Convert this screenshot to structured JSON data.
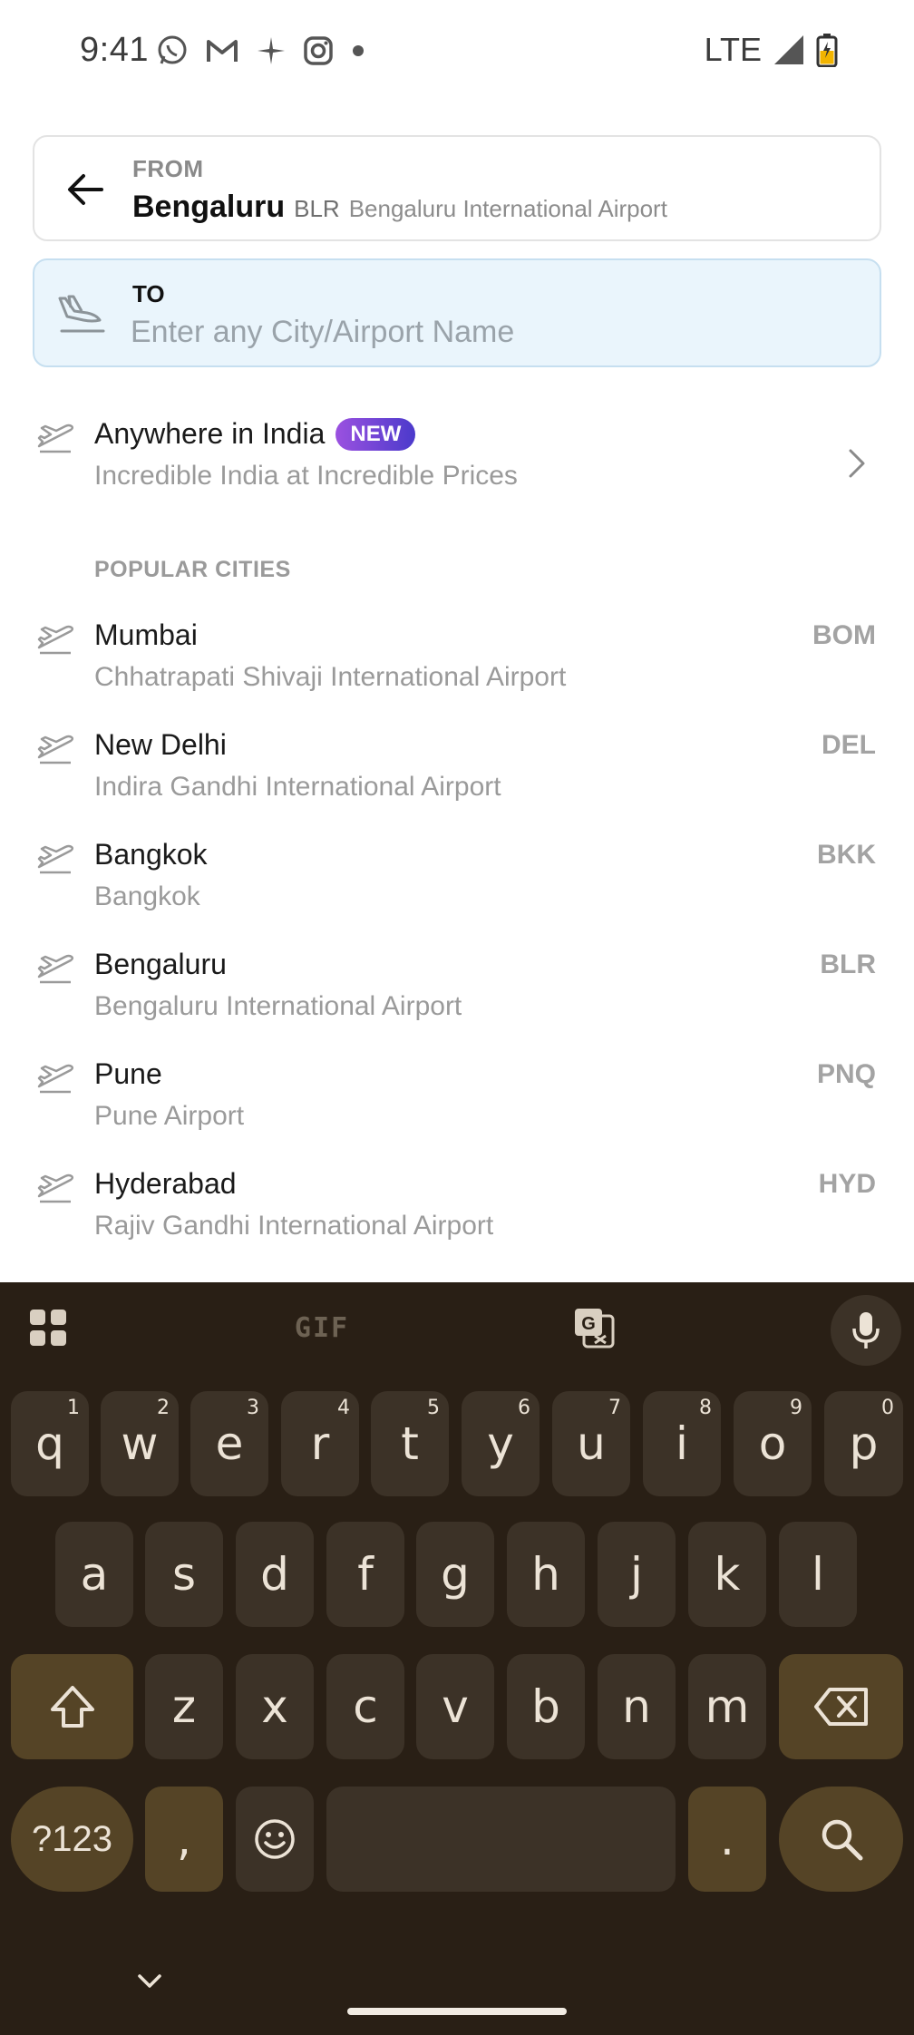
{
  "status_bar": {
    "time": "9:41",
    "notification_icons": [
      "whatsapp-icon",
      "gmail-icon",
      "pinwheel-icon",
      "instagram-icon",
      "dot-icon"
    ],
    "network": "LTE",
    "signal_icon": "signal-icon",
    "battery_icon": "battery-charging-icon"
  },
  "from": {
    "label": "FROM",
    "city": "Bengaluru",
    "code": "BLR",
    "airport": "Bengaluru International Airport",
    "back_icon": "arrow-left-icon"
  },
  "to": {
    "label": "TO",
    "placeholder": "Enter any City/Airport Name",
    "value": "",
    "icon": "plane-landing-icon"
  },
  "anywhere": {
    "title": "Anywhere in India",
    "badge": "NEW",
    "subtitle": "Incredible India at Incredible Prices"
  },
  "popular": {
    "section_label": "POPULAR CITIES",
    "cities": [
      {
        "name": "Mumbai",
        "airport": "Chhatrapati Shivaji International Airport",
        "code": "BOM"
      },
      {
        "name": "New Delhi",
        "airport": "Indira Gandhi International Airport",
        "code": "DEL"
      },
      {
        "name": "Bangkok",
        "airport": "Bangkok",
        "code": "BKK"
      },
      {
        "name": "Bengaluru",
        "airport": "Bengaluru International Airport",
        "code": "BLR"
      },
      {
        "name": "Pune",
        "airport": "Pune Airport",
        "code": "PNQ"
      },
      {
        "name": "Hyderabad",
        "airport": "Rajiv Gandhi International Airport",
        "code": "HYD"
      }
    ]
  },
  "keyboard": {
    "toolbar": {
      "gif": "GIF"
    },
    "row1": [
      {
        "k": "q",
        "h": "1"
      },
      {
        "k": "w",
        "h": "2"
      },
      {
        "k": "e",
        "h": "3"
      },
      {
        "k": "r",
        "h": "4"
      },
      {
        "k": "t",
        "h": "5"
      },
      {
        "k": "y",
        "h": "6"
      },
      {
        "k": "u",
        "h": "7"
      },
      {
        "k": "i",
        "h": "8"
      },
      {
        "k": "o",
        "h": "9"
      },
      {
        "k": "p",
        "h": "0"
      }
    ],
    "row2": [
      "a",
      "s",
      "d",
      "f",
      "g",
      "h",
      "j",
      "k",
      "l"
    ],
    "row3": [
      "z",
      "x",
      "c",
      "v",
      "b",
      "n",
      "m"
    ],
    "symbols_label": "?123",
    "comma": ",",
    "period": ".",
    "colors": {
      "background": "#291f15",
      "key": "#3c3227",
      "function_key": "#554426",
      "text": "#ece3d6"
    }
  }
}
